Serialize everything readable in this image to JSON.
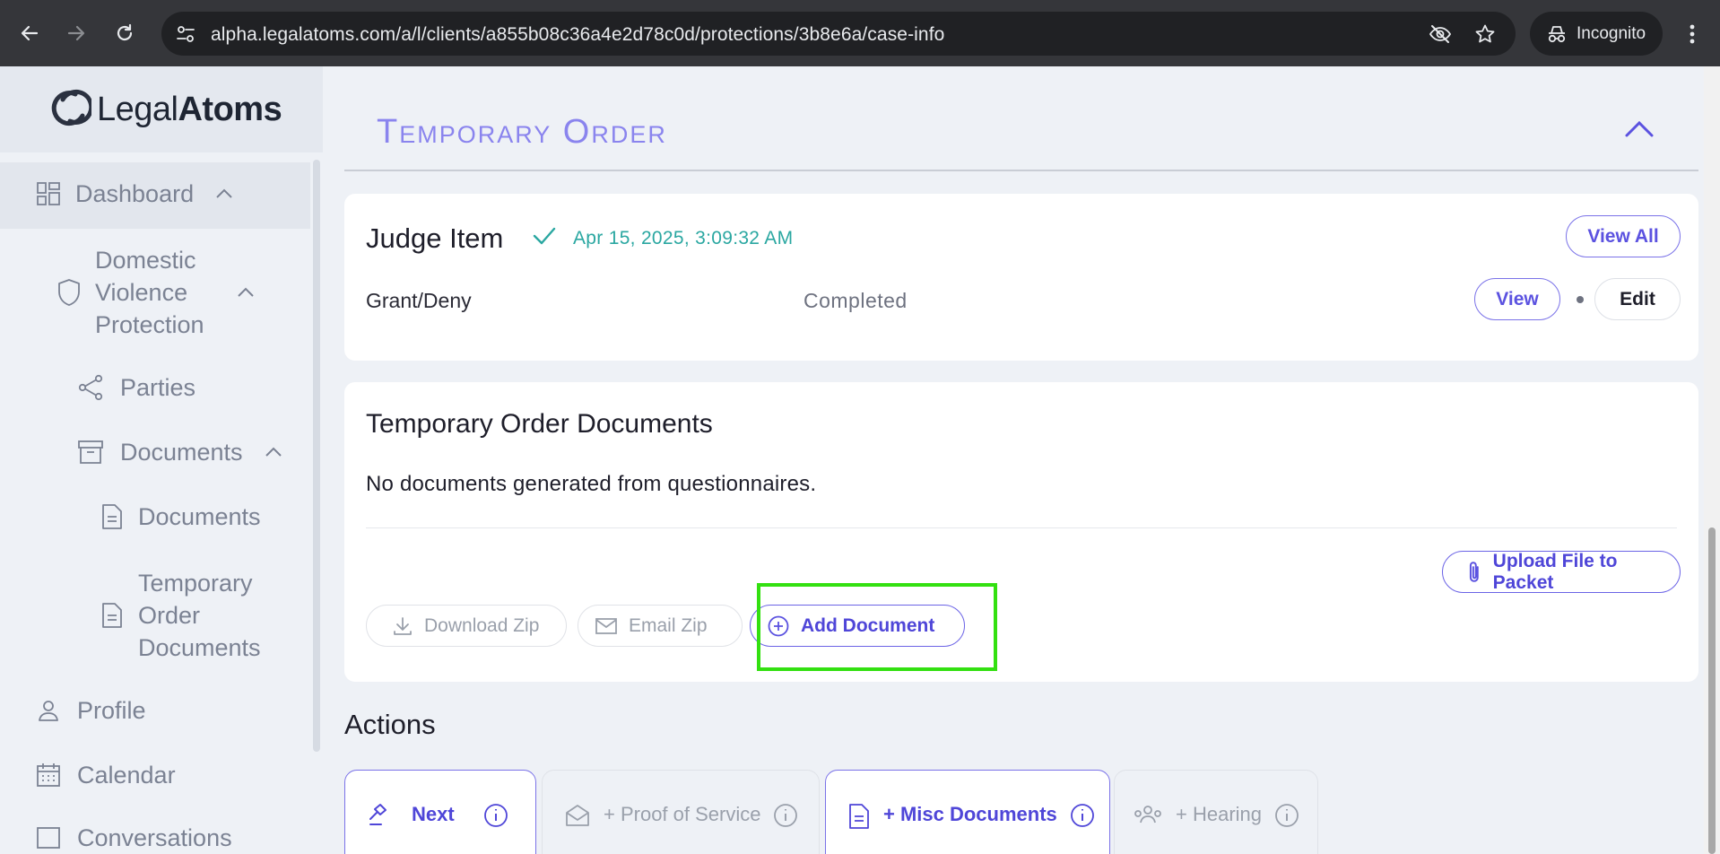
{
  "browser": {
    "url": "alpha.legalatoms.com/a/l/clients/a855b08c36a4e2d78c0d/protections/3b8e6a/case-info",
    "incognito_label": "Incognito"
  },
  "sidebar": {
    "logo": {
      "light": "Legal",
      "bold": "Atoms"
    },
    "items": [
      {
        "label": "Dashboard",
        "icon": "grid-icon"
      },
      {
        "label": "Domestic Violence Protection",
        "icon": "shield-icon"
      },
      {
        "label": "Parties",
        "icon": "share-icon"
      },
      {
        "label": "Documents",
        "icon": "archive-icon"
      },
      {
        "label": "Documents",
        "icon": "file-icon"
      },
      {
        "label": "Temporary Order Documents",
        "icon": "file-icon"
      },
      {
        "label": "Profile",
        "icon": "user-icon"
      },
      {
        "label": "Calendar",
        "icon": "calendar-icon"
      },
      {
        "label": "Conversations",
        "icon": "chat-icon"
      }
    ]
  },
  "section": {
    "title": "Temporary Order"
  },
  "judge_card": {
    "title": "Judge Item",
    "timestamp": "Apr 15, 2025, 3:09:32 AM",
    "view_all": "View All",
    "row": {
      "label": "Grant/Deny",
      "status": "Completed",
      "view": "View",
      "edit": "Edit"
    }
  },
  "documents_card": {
    "title": "Temporary Order Documents",
    "empty_message": "No documents generated from questionnaires.",
    "upload": "Upload File to Packet",
    "download_zip": "Download Zip",
    "email_zip": "Email Zip",
    "add_document": "Add Document"
  },
  "actions": {
    "title": "Actions",
    "items": [
      {
        "label": "Next",
        "enabled": true
      },
      {
        "label": "+ Proof of Service",
        "enabled": false
      },
      {
        "label": "+ Misc Documents",
        "enabled": true
      },
      {
        "label": "+ Hearing",
        "enabled": false
      }
    ]
  },
  "colors": {
    "accent": "#5b52e0",
    "teal": "#2aa7a1",
    "highlight": "#33e010"
  }
}
